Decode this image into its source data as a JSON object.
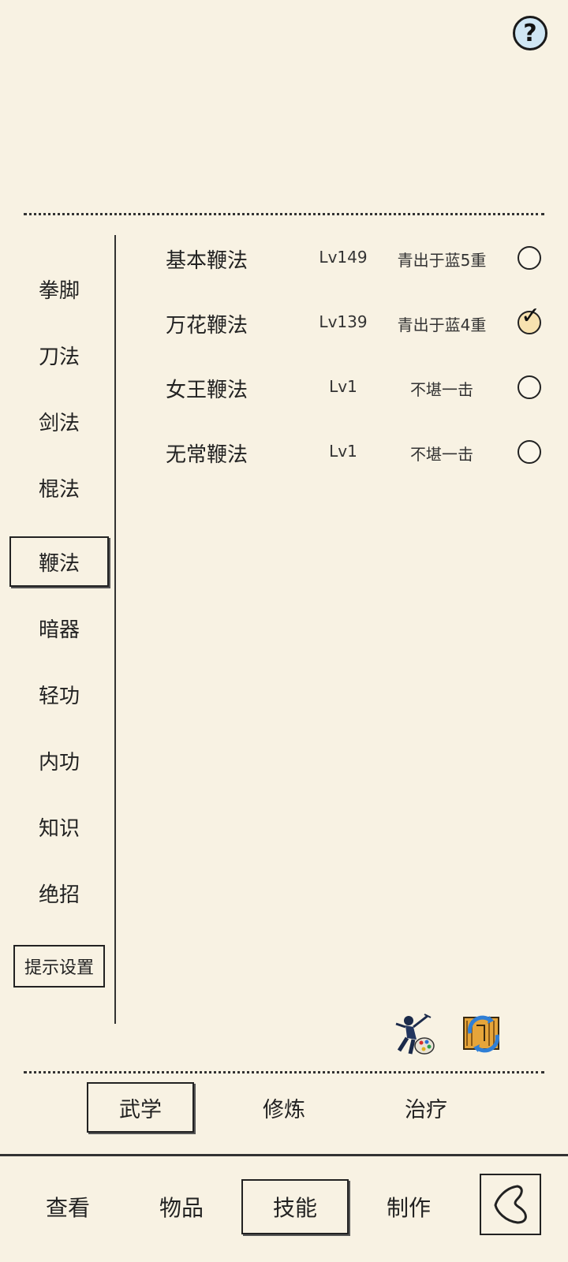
{
  "help": {
    "label": "?"
  },
  "nav": {
    "items": [
      {
        "label": "拳脚"
      },
      {
        "label": "刀法"
      },
      {
        "label": "剑法"
      },
      {
        "label": "棍法"
      },
      {
        "label": "鞭法"
      },
      {
        "label": "暗器"
      },
      {
        "label": "轻功"
      },
      {
        "label": "内功"
      },
      {
        "label": "知识"
      },
      {
        "label": "绝招"
      }
    ],
    "active": "鞭法",
    "settings_label": "提示设置"
  },
  "skills": [
    {
      "name": "基本鞭法",
      "level": "Lv149",
      "rank": "青出于蓝5重",
      "selected": false
    },
    {
      "name": "万花鞭法",
      "level": "Lv139",
      "rank": "青出于蓝4重",
      "selected": true
    },
    {
      "name": "女王鞭法",
      "level": "Lv1",
      "rank": "不堪一击",
      "selected": false
    },
    {
      "name": "无常鞭法",
      "level": "Lv1",
      "rank": "不堪一击",
      "selected": false
    }
  ],
  "action_icons": [
    "martial-arts-palette-icon",
    "book-swap-icon"
  ],
  "subtabs": {
    "items": [
      {
        "label": "武学"
      },
      {
        "label": "修炼"
      },
      {
        "label": "治疗"
      }
    ],
    "active": "武学"
  },
  "main_tabs": {
    "items": [
      {
        "label": "查看"
      },
      {
        "label": "物品"
      },
      {
        "label": "技能"
      },
      {
        "label": "制作"
      }
    ],
    "active": "技能"
  },
  "colors": {
    "background": "#f8f2e3",
    "help_button": "#cfe6f4",
    "checked_radio": "#f7e2b0"
  }
}
